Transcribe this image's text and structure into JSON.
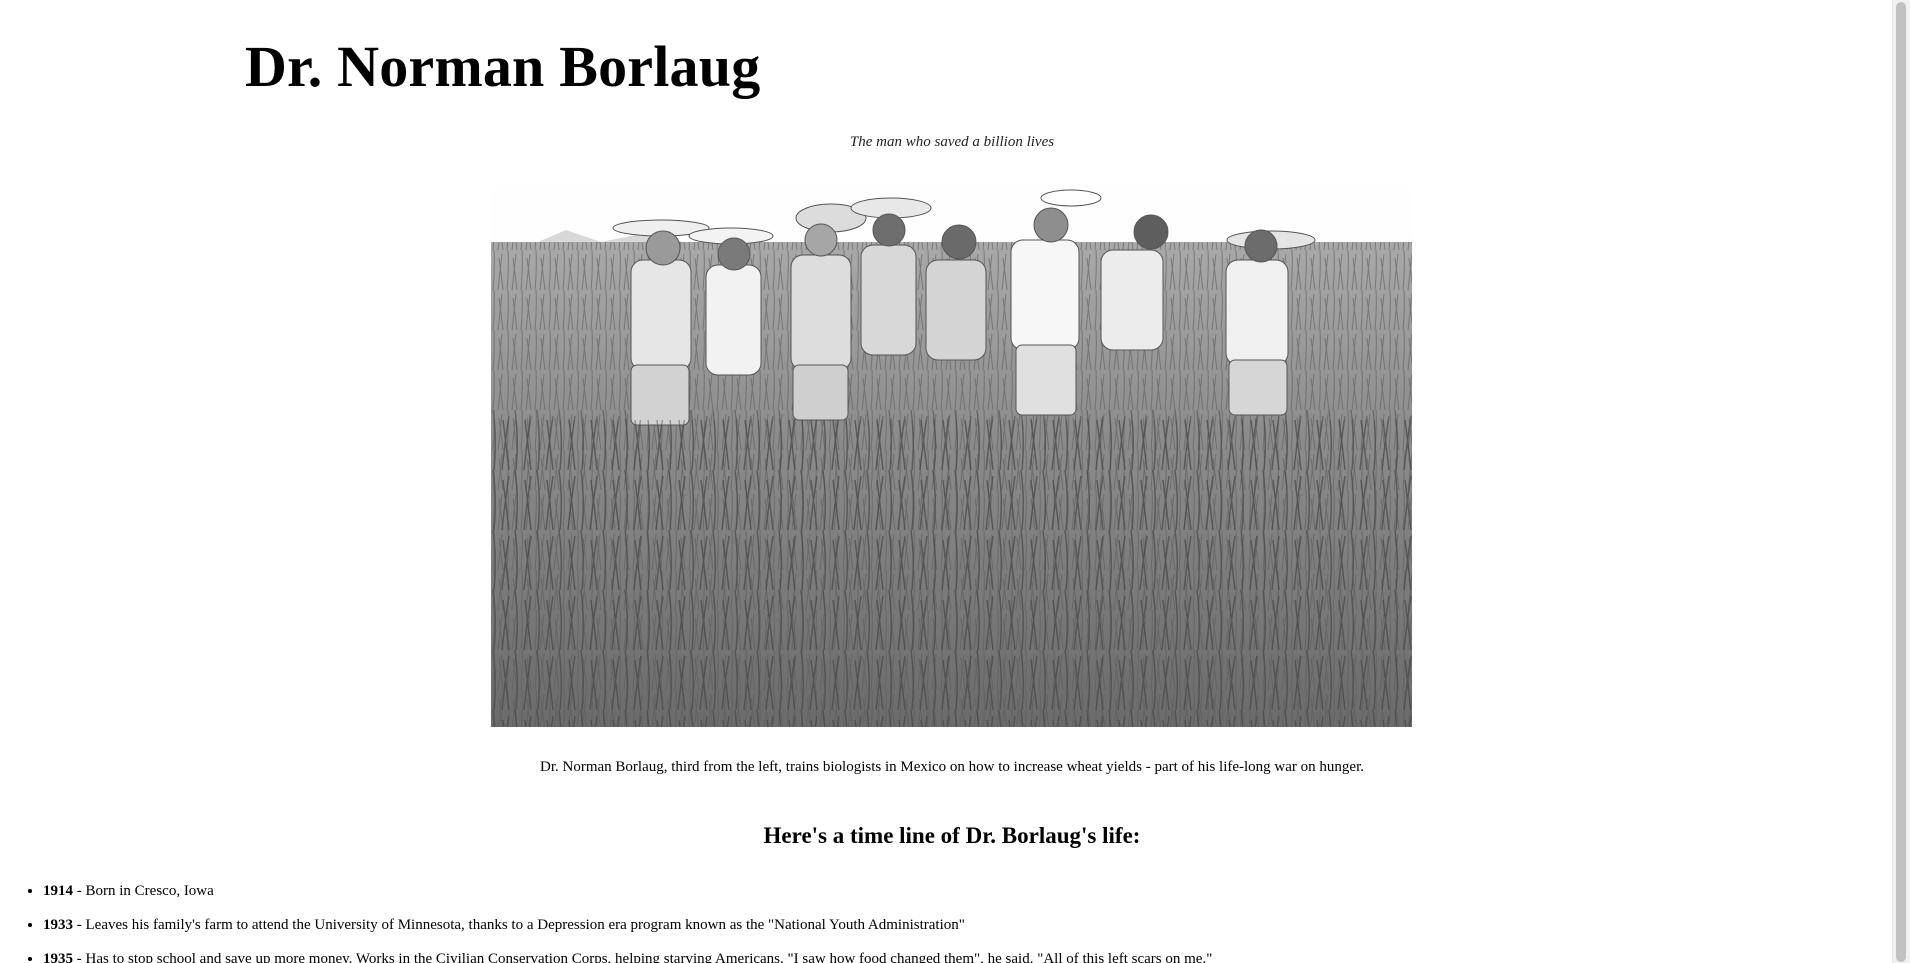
{
  "page": {
    "title": "Dr. Norman Borlaug",
    "tagline": "The man who saved a billion lives",
    "image_alt": "Dr. Norman Borlaug with biologists in a wheat field in Mexico",
    "caption": "Dr. Norman Borlaug, third from the left, trains biologists in Mexico on how to increase wheat yields - part of his life-long war on hunger.",
    "timeline_heading": "Here's a time line of Dr. Borlaug's life:"
  },
  "timeline": [
    {
      "year": "1914",
      "text": " - Born in Cresco, Iowa"
    },
    {
      "year": "1933",
      "text": " - Leaves his family's farm to attend the University of Minnesota, thanks to a Depression era program known as the \"National Youth Administration\""
    },
    {
      "year": "1935",
      "text": " - Has to stop school and save up more money. Works in the Civilian Conservation Corps, helping starving Americans. \"I saw how food changed them\", he said. \"All of this left scars on me.\""
    }
  ]
}
